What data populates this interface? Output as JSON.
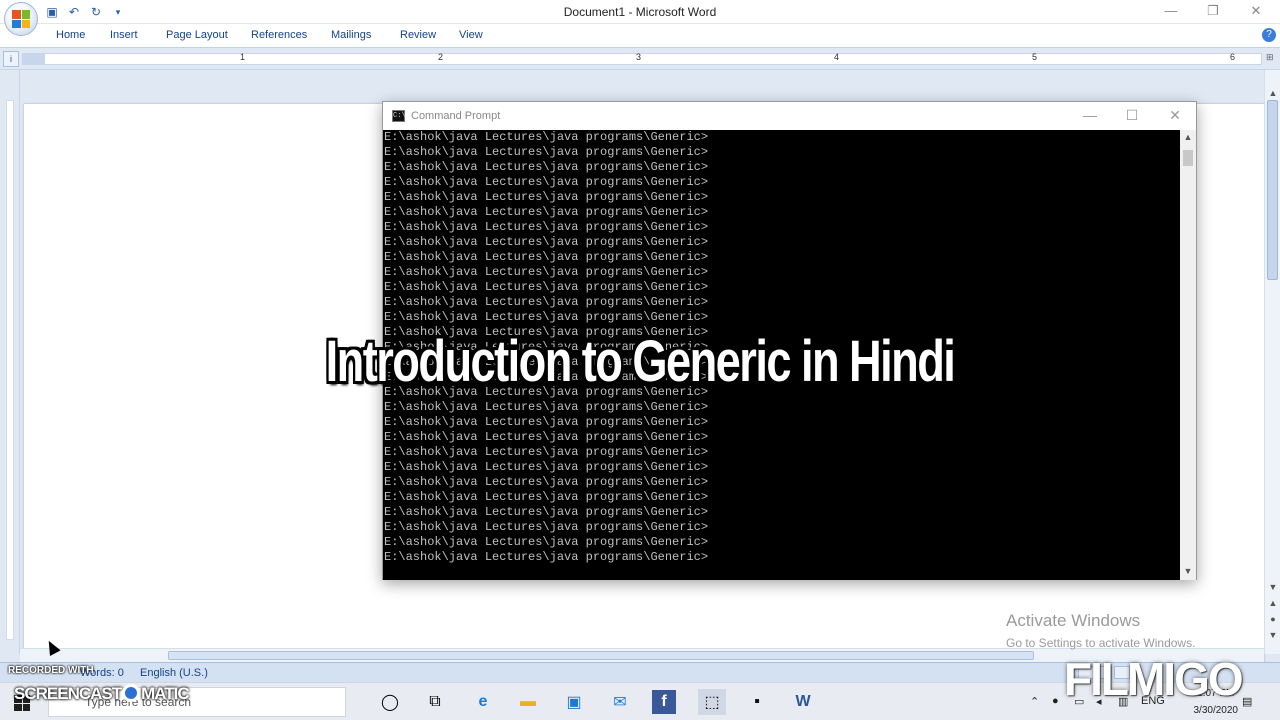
{
  "word": {
    "title": "Document1 - Microsoft Word",
    "tabs": [
      "Home",
      "Insert",
      "Page Layout",
      "References",
      "Mailings",
      "Review",
      "View"
    ],
    "ruler_numbers": [
      "1",
      "2",
      "3",
      "4",
      "5",
      "6"
    ],
    "status": {
      "words": "Words: 0",
      "language": "English (U.S.)"
    }
  },
  "cmd": {
    "title": "Command Prompt",
    "prompt_line": "E:\\ashok\\java Lectures\\java programs\\Generic>",
    "lines": [
      "E:\\ashok\\java Lectures\\java programs\\Generic>",
      "E:\\ashok\\java Lectures\\java programs\\Generic>",
      "E:\\ashok\\java Lectures\\java programs\\Generic>",
      "E:\\ashok\\java Lectures\\java programs\\Generic>",
      "E:\\ashok\\java Lectures\\java programs\\Generic>",
      "E:\\ashok\\java Lectures\\java programs\\Generic>",
      "E:\\ashok\\java Lectures\\java programs\\Generic>",
      "E:\\ashok\\java Lectures\\java programs\\Generic>",
      "E:\\ashok\\java Lectures\\java programs\\Generic>",
      "E:\\ashok\\java Lectures\\java programs\\Generic>",
      "E:\\ashok\\java Lectures\\java programs\\Generic>",
      "E:\\ashok\\java Lectures\\java programs\\Generic>",
      "E:\\ashok\\java Lectures\\java programs\\Generic>",
      "E:\\ashok\\java Lectures\\java programs\\Generic>",
      "E:\\ashok\\java Lectures\\java programs\\Generic>",
      "E:\\ashok\\java Lectures\\java programs\\Generic>",
      "E:\\ashok\\java Lectures\\java programs\\Generic>",
      "E:\\ashok\\java Lectures\\java programs\\Generic>",
      "E:\\ashok\\java Lectures\\java programs\\Generic>",
      "E:\\ashok\\java Lectures\\java programs\\Generic>",
      "E:\\ashok\\java Lectures\\java programs\\Generic>",
      "E:\\ashok\\java Lectures\\java programs\\Generic>",
      "E:\\ashok\\java Lectures\\java programs\\Generic>",
      "E:\\ashok\\java Lectures\\java programs\\Generic>",
      "E:\\ashok\\java Lectures\\java programs\\Generic>",
      "E:\\ashok\\java Lectures\\java programs\\Generic>",
      "E:\\ashok\\java Lectures\\java programs\\Generic>",
      "E:\\ashok\\java Lectures\\java programs\\Generic>",
      "E:\\ashok\\java Lectures\\java programs\\Generic>"
    ]
  },
  "overlay": {
    "video_title": "Introduction to Generic in Hindi",
    "activate_line1": "Activate Windows",
    "activate_line2": "Go to Settings to activate Windows.",
    "filmigo": "FILMIGO",
    "recorded_with": "RECORDED WITH",
    "screencast_brand_left": "SCREENCAST",
    "screencast_brand_right": "MATIC"
  },
  "taskbar": {
    "search_placeholder": "Type here to search",
    "language": "ENG",
    "time": "1:07 PM",
    "date": "3/30/2020"
  },
  "colors": {
    "ribbon_text": "#15428b",
    "console_bg": "#000000",
    "console_text": "#c0c0c0",
    "status_bar": "#d4e1f2"
  }
}
